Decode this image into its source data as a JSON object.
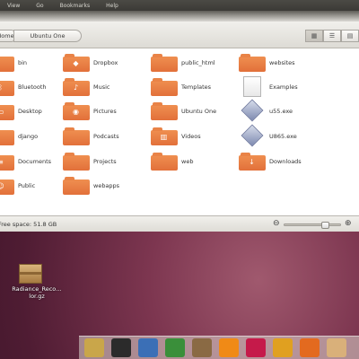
{
  "menu": [
    "View",
    "Go",
    "Bookmarks",
    "Help"
  ],
  "toolbar": {
    "breadcrumbs": [
      "Home",
      "Ubuntu One"
    ],
    "view_icons": [
      "icon-view-icon",
      "list-view-icon",
      "compact-view-icon"
    ]
  },
  "files": [
    {
      "label": "bin",
      "type": "folder"
    },
    {
      "label": "Dropbox",
      "type": "folder",
      "emblem": "dropbox-icon"
    },
    {
      "label": "public_html",
      "type": "folder"
    },
    {
      "label": "websites",
      "type": "folder"
    },
    {
      "label": "Bluetooth",
      "type": "folder",
      "emblem": "bluetooth-icon"
    },
    {
      "label": "Music",
      "type": "folder",
      "emblem": "music-icon"
    },
    {
      "label": "Templates",
      "type": "folder"
    },
    {
      "label": "Examples",
      "type": "document"
    },
    {
      "label": "Desktop",
      "type": "folder",
      "emblem": "desktop-icon"
    },
    {
      "label": "Pictures",
      "type": "folder",
      "emblem": "camera-icon"
    },
    {
      "label": "Ubuntu One",
      "type": "folder"
    },
    {
      "label": "u55.exe",
      "type": "executable"
    },
    {
      "label": "django",
      "type": "folder"
    },
    {
      "label": "Podcasts",
      "type": "folder"
    },
    {
      "label": "Videos",
      "type": "folder",
      "emblem": "film-icon"
    },
    {
      "label": "U865.exe",
      "type": "executable"
    },
    {
      "label": "Documents",
      "type": "folder",
      "emblem": "document-icon"
    },
    {
      "label": "Projects",
      "type": "folder"
    },
    {
      "label": "web",
      "type": "folder"
    },
    {
      "label": "Downloads",
      "type": "folder",
      "emblem": "download-icon"
    },
    {
      "label": "Public",
      "type": "folder",
      "emblem": "user-icon"
    },
    {
      "label": "webapps",
      "type": "folder"
    }
  ],
  "status": {
    "free_space": "Free space: 51.8 GB",
    "zoom_level": 0.72
  },
  "desktop": {
    "icon_label": "Radiance_Reco…lor.gz"
  },
  "dock": {
    "launchers": [
      {
        "name": "home-launcher",
        "color": "#c9a64a"
      },
      {
        "name": "terminal-launcher",
        "color": "#2b2b2b"
      },
      {
        "name": "browser-launcher",
        "color": "#3b6fb6"
      },
      {
        "name": "vim-launcher",
        "color": "#3a8f3a"
      },
      {
        "name": "photos-launcher",
        "color": "#8a6a44"
      },
      {
        "name": "vlc-launcher",
        "color": "#f08a16"
      },
      {
        "name": "music-launcher",
        "color": "#c51a4a"
      },
      {
        "name": "chat-launcher",
        "color": "#e0a020"
      },
      {
        "name": "firefox-launcher",
        "color": "#e36a1f"
      },
      {
        "name": "files-launcher",
        "color": "#d9b07a"
      }
    ]
  },
  "colors": {
    "folder_orange": "#e2703a",
    "wallpaper": "#6b2a45"
  }
}
